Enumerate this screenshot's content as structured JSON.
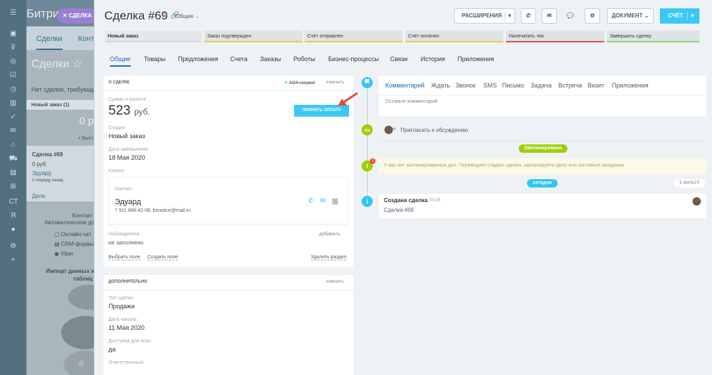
{
  "background": {
    "logo": "Битри",
    "pill_label": "СДЕЛКА",
    "tab_deals": "Сделки",
    "tab_contacts": "Конта",
    "title": "Сделки",
    "notice": "Нет сделок, требующих",
    "column_label": "Новый заказ",
    "column_count": "(1)",
    "column_sum": "0 р",
    "quick_add": "+ Быстр",
    "card_title": "Сделка #69",
    "card_sum": "0 руб.",
    "card_client": "Эдуард",
    "card_time": "1 секунду назад",
    "card_cases": "Дела",
    "contact_line1": "Контакт",
    "contact_line2": "Автоматическое до",
    "chat_line": "Онлайн-чат",
    "crm_forms": "CRM-формы",
    "viber": "Viber",
    "import_line1": "Импорт данных из",
    "import_line2": "таблиц"
  },
  "header": {
    "title": "Сделка",
    "number": "#69",
    "category": "Общее",
    "btn_extensions": "РАСШИРЕНИЯ",
    "btn_document": "ДОКУМЕНТ",
    "btn_invoice": "СЧЁТ"
  },
  "stages": [
    {
      "label": "Новый заказ",
      "color": "#d3d7da",
      "bold": true
    },
    {
      "label": "Заказ подтвержден",
      "color": "#f2c744"
    },
    {
      "label": "Счёт отправлен",
      "color": "#f2c744"
    },
    {
      "label": "Счёт оплачен",
      "color": "#f2c744"
    },
    {
      "label": "Напечатать чек",
      "color": "#e8463e"
    },
    {
      "label": "Завершить сделку",
      "color": "#8bd86e"
    }
  ],
  "tabs": [
    "Общие",
    "Товары",
    "Предложения",
    "Счета",
    "Заказы",
    "Роботы",
    "Бизнес-процессы",
    "Связи",
    "История",
    "Приложения"
  ],
  "about": {
    "title": "О СДЕЛКЕ",
    "scoring": "AI24-скоринг",
    "edit": "изменить",
    "sum_label": "Сумма и валюта",
    "amount": "523",
    "currency": "руб.",
    "pay_button": "ПРИНЯТЬ ОПЛАТУ",
    "stage_label": "Стадия",
    "stage_value": "Новый заказ",
    "close_label": "Дата завершения",
    "close_value": "18 Мая 2020",
    "client_label": "Клиент",
    "contact_label": "Контакт",
    "contact_name": "Эдуард",
    "contact_info": "7 911 868-42-08, bxnotice@mail.ru",
    "observers_label": "Наблюдатели",
    "observers_add": "добавить",
    "observers_value": "не заполнено",
    "choose_field": "Выбрать поле",
    "create_field": "Создать поле",
    "delete_section": "Удалить раздел"
  },
  "extra": {
    "title": "ДОПОЛНИТЕЛЬНО",
    "edit": "изменить",
    "type_label": "Тип сделки",
    "type_value": "Продажа",
    "start_label": "Дата начала",
    "start_value": "11 Мая 2020",
    "access_label": "Доступна для всех",
    "access_value": "да",
    "responsible_label": "Ответственный"
  },
  "timeline": {
    "tabs": [
      "Комментарий",
      "Ждать",
      "Звонок",
      "SMS",
      "Письмо",
      "Задача",
      "Встреча",
      "Визит",
      "Приложения"
    ],
    "comment_placeholder": "Оставьте комментарий",
    "invite": "Пригласить к обсуждению",
    "planned": "Запланировано",
    "no_plans": "У вас нет запланированных дел. Переведите стадию сделки, запланируйте дело или поставьте ожидание",
    "today": "сегодня",
    "filter": "ФИЛЬТР",
    "created_title": "Создана сделка",
    "created_time": "15:08",
    "created_deal": "Сделка #69",
    "badge_count": "1"
  },
  "colors": {
    "accent": "#3bc8f5",
    "link": "#2067b0",
    "green": "#9dcf00"
  }
}
